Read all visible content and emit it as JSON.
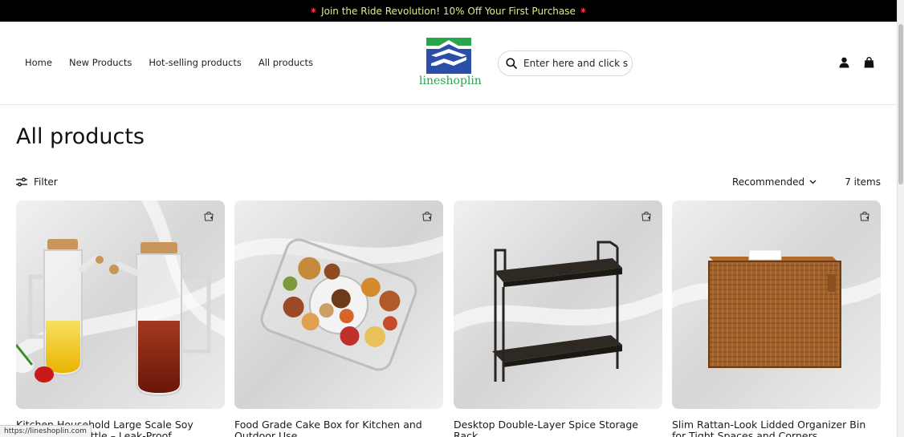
{
  "announcement": {
    "burst_left": "✷",
    "text": "Join the Ride Revolution! 10% Off Your First Purchase",
    "burst_right": "✷"
  },
  "nav": [
    "Home",
    "New Products",
    "Hot-selling products",
    "All products"
  ],
  "logo": {
    "brand": "lineshoplin"
  },
  "search": {
    "placeholder": "Enter here and click search"
  },
  "icons": {
    "search": "search-icon",
    "account": "account-icon",
    "cart": "shopping-bag-icon",
    "filter": "sliders-icon",
    "sort": "chevron-down-icon",
    "add_to_cart": "add-to-cart-icon"
  },
  "page": {
    "title": "All products"
  },
  "toolbar": {
    "filter_label": "Filter",
    "sort_label": "Recommended",
    "count": "7 items"
  },
  "products": [
    {
      "title": "Kitchen Household Large Scale Soy Sauce & Oil Bottle – Leak-Proof Seasoning"
    },
    {
      "title": "Food Grade Cake Box for Kitchen and Outdoor Use"
    },
    {
      "title": "Desktop Double-Layer Spice Storage Rack"
    },
    {
      "title": "Slim Rattan-Look Lidded Organizer Bin for Tight Spaces and Corners"
    }
  ],
  "statusbar": {
    "url": "https://lineshoplin.com"
  },
  "colors": {
    "announcement_bg": "#000000",
    "announcement_text": "#d9f27a",
    "logo_green": "#27a64a",
    "logo_blue": "#2b4fa8"
  }
}
